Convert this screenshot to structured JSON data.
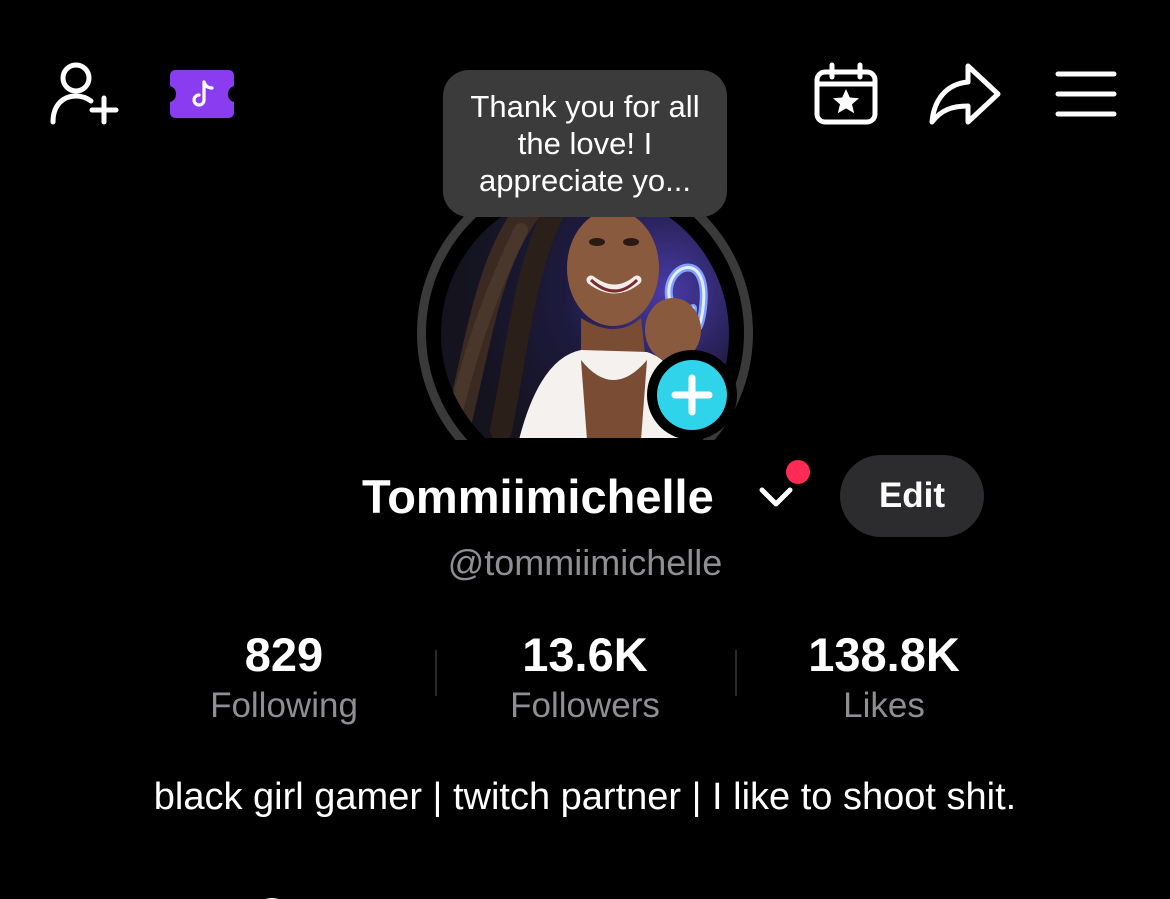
{
  "header": {
    "icons": {
      "add_friend": "person-plus-icon",
      "promo": "tiktok-ticket-icon",
      "calendar": "calendar-star-icon",
      "share": "share-arrow-icon",
      "menu": "hamburger-menu-icon"
    }
  },
  "profile": {
    "status_note": "Thank you for all the love! I appreciate yo...",
    "display_name": "Tommiimichelle",
    "username": "@tommiimichelle",
    "edit_label": "Edit",
    "bio": "black girl gamer | twitch partner | I like to shoot shit."
  },
  "stats": [
    {
      "value": "829",
      "label": "Following"
    },
    {
      "value": "13.6K",
      "label": "Followers"
    },
    {
      "value": "138.8K",
      "label": "Likes"
    }
  ],
  "colors": {
    "background": "#000000",
    "accent_add": "#2fd3ea",
    "notification_dot": "#fe2c55",
    "promo_purple": "#8a3cf0",
    "muted_text": "#8e8e93",
    "edit_button_bg": "#2c2c2e",
    "tooltip_bg": "#3b3b3b"
  }
}
